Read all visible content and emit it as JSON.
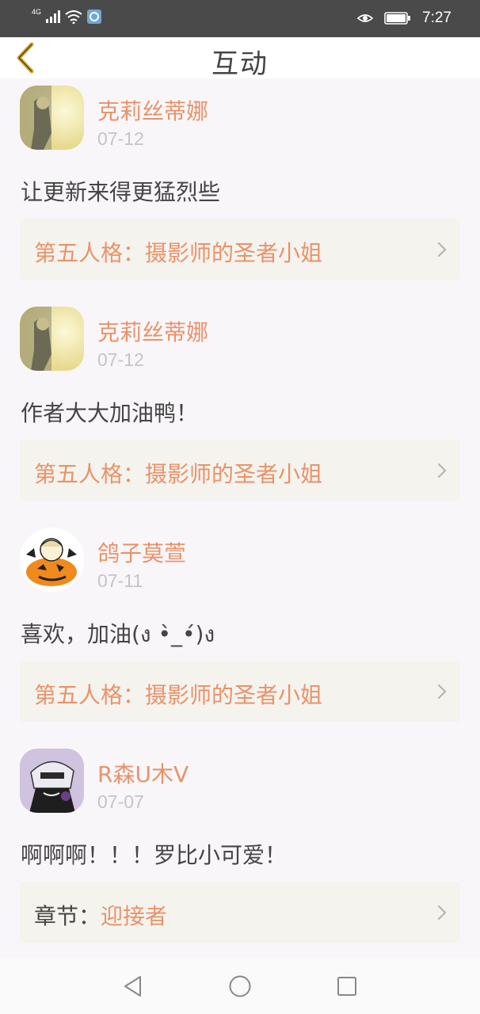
{
  "status_bar": {
    "network": "4G",
    "time": "7:27",
    "icons": [
      "signal-icon",
      "wifi-icon",
      "app-notification-icon",
      "eye-icon",
      "battery-icon"
    ]
  },
  "header": {
    "title": "互动",
    "back_icon": "chevron-left-icon"
  },
  "comments": [
    {
      "username": "克莉丝蒂娜",
      "date": "07-12",
      "text": "让更新来得更猛烈些",
      "link_prefix": "",
      "link_title": "第五人格：摄影师的圣者小姐"
    },
    {
      "username": "克莉丝蒂娜",
      "date": "07-12",
      "text": "作者大大加油鸭！",
      "link_prefix": "",
      "link_title": "第五人格：摄影师的圣者小姐"
    },
    {
      "username": "鸽子莫萱",
      "date": "07-11",
      "text": "喜欢，加油(ง •̀_•́)ง",
      "link_prefix": "",
      "link_title": "第五人格：摄影师的圣者小姐"
    },
    {
      "username": "R森U木V",
      "date": "07-07",
      "text": "啊啊啊！！！罗比小可爱！",
      "link_prefix": "章节：",
      "link_title": "迎接者"
    }
  ],
  "nav_bar": {
    "icons": [
      "back-triangle-icon",
      "home-circle-icon",
      "recents-square-icon"
    ]
  },
  "colors": {
    "accent": "#e8936a",
    "back_arrow": "#d4a62a",
    "card_bg": "#f4f3ee",
    "page_bg": "#f9f6f9"
  }
}
